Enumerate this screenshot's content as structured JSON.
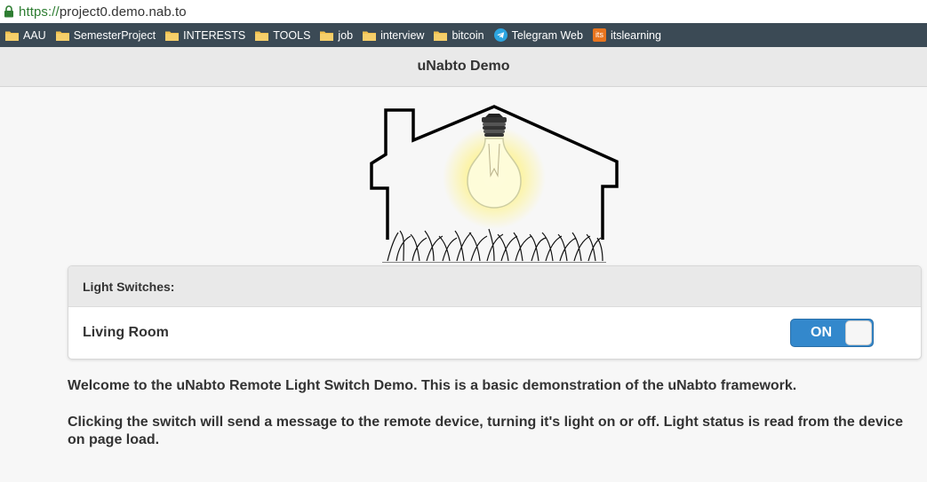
{
  "browser": {
    "url_scheme": "https://",
    "url_rest": "project0.demo.nab.to",
    "bookmarks": [
      {
        "label": "AAU",
        "icon": "folder-icon"
      },
      {
        "label": "SemesterProject",
        "icon": "folder-icon"
      },
      {
        "label": "INTERESTS",
        "icon": "folder-icon"
      },
      {
        "label": "TOOLS",
        "icon": "folder-icon"
      },
      {
        "label": "job",
        "icon": "folder-icon"
      },
      {
        "label": "interview",
        "icon": "folder-icon"
      },
      {
        "label": "bitcoin",
        "icon": "folder-icon"
      },
      {
        "label": "Telegram Web",
        "icon": "telegram-icon"
      },
      {
        "label": "itslearning",
        "icon": "itslearning-icon"
      }
    ],
    "itslearning_badge": "its"
  },
  "page": {
    "title": "uNabto Demo"
  },
  "switches": {
    "header": "Light Switches:",
    "items": [
      {
        "label": "Living Room",
        "state": "ON"
      }
    ]
  },
  "content": {
    "intro": "Welcome to the uNabto Remote Light Switch Demo. This is a basic demonstration of the uNabto framework.",
    "details": "Clicking the switch will send a message to the remote device, turning it's light on or off. Light status is read from the device on page load."
  },
  "colors": {
    "toggle_on": "#3388cc",
    "bookmark_bar": "#3b4a55",
    "folder": "#f2c14e",
    "telegram": "#2ca5e0",
    "itslearning": "#e8741e"
  }
}
